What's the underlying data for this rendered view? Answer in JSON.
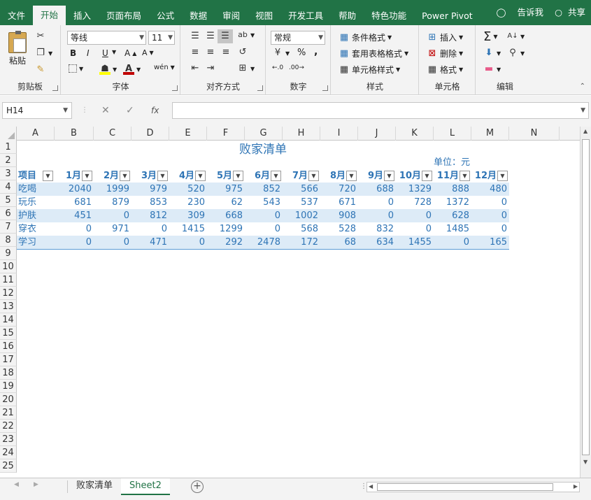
{
  "menu": {
    "tabs": [
      "文件",
      "开始",
      "插入",
      "页面布局",
      "公式",
      "数据",
      "审阅",
      "视图",
      "开发工具",
      "帮助",
      "特色功能",
      "Power Pivot"
    ],
    "tell_me": "告诉我",
    "share": "共享"
  },
  "ribbon": {
    "clipboard": {
      "label": "剪贴板",
      "paste": "粘贴"
    },
    "font": {
      "label": "字体",
      "name": "等线",
      "size": "11",
      "bold": "B",
      "italic": "I",
      "underline": "U",
      "font_color": "A",
      "phonetic": "wén"
    },
    "align": {
      "label": "对齐方式"
    },
    "number": {
      "label": "数字",
      "format": "常规",
      "percent": "%",
      "comma": ","
    },
    "styles": {
      "label": "样式",
      "cond": "条件格式",
      "table": "套用表格格式",
      "cell": "单元格样式"
    },
    "cells": {
      "label": "单元格",
      "insert": "插入",
      "delete": "删除",
      "format": "格式"
    },
    "edit": {
      "label": "编辑"
    }
  },
  "formula_bar": {
    "name_box": "H14",
    "value": "",
    "fx": "fx"
  },
  "columns": [
    "A",
    "B",
    "C",
    "D",
    "E",
    "F",
    "G",
    "H",
    "I",
    "J",
    "K",
    "L",
    "M",
    "N"
  ],
  "rows": [
    "1",
    "2",
    "3",
    "4",
    "5",
    "6",
    "7",
    "8",
    "9",
    "10",
    "11",
    "12",
    "13",
    "14",
    "15",
    "16",
    "17",
    "18",
    "19",
    "20",
    "21",
    "22",
    "23",
    "24",
    "25"
  ],
  "sheet": {
    "title": "败家清单",
    "unit": "单位：元",
    "headers": [
      "项目",
      "1月",
      "2月",
      "3月",
      "4月",
      "5月",
      "6月",
      "7月",
      "8月",
      "9月",
      "10月",
      "11月",
      "12月"
    ],
    "data": [
      [
        "吃喝",
        "2040",
        "1999",
        "979",
        "520",
        "975",
        "852",
        "566",
        "720",
        "688",
        "1329",
        "888",
        "480"
      ],
      [
        "玩乐",
        "681",
        "879",
        "853",
        "230",
        "62",
        "543",
        "537",
        "671",
        "0",
        "728",
        "1372",
        "0"
      ],
      [
        "护肤",
        "451",
        "0",
        "812",
        "309",
        "668",
        "0",
        "1002",
        "908",
        "0",
        "0",
        "628",
        "0"
      ],
      [
        "穿衣",
        "0",
        "971",
        "0",
        "1415",
        "1299",
        "0",
        "568",
        "528",
        "832",
        "0",
        "1485",
        "0"
      ],
      [
        "学习",
        "0",
        "0",
        "471",
        "0",
        "292",
        "2478",
        "172",
        "68",
        "634",
        "1455",
        "0",
        "165"
      ]
    ]
  },
  "sheet_tabs": [
    "败家清单",
    "Sheet2"
  ],
  "active_sheet": "Sheet2",
  "colors": {
    "excel_green": "#217346",
    "table_text": "#2e74b5",
    "band": "#ddebf7"
  }
}
